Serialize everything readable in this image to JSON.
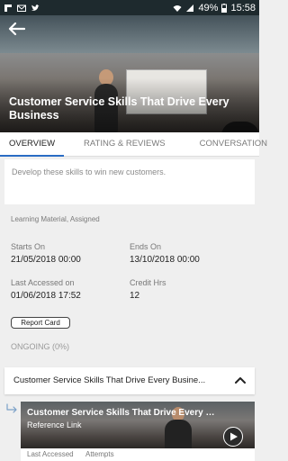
{
  "status_bar": {
    "battery": "49%",
    "time": "15:58",
    "icons": [
      "flipboard-icon",
      "gmail-icon",
      "twitter-icon",
      "wifi-icon",
      "signal-icon",
      "battery-icon"
    ]
  },
  "header": {
    "back_icon": "arrow-left-icon",
    "title": "Customer Service Skills That Drive Every Business"
  },
  "tabs": [
    {
      "label": "OVERVIEW",
      "active": true
    },
    {
      "label": "RATING & REVIEWS",
      "active": false
    },
    {
      "label": "CONVERSATION",
      "active": false
    }
  ],
  "overview": {
    "description": "Develop these skills to win new customers.",
    "meta": "Learning Material, Assigned",
    "starts_on_label": "Starts On",
    "starts_on_value": "21/05/2018 00:00",
    "ends_on_label": "Ends On",
    "ends_on_value": "13/10/2018 00:00",
    "last_accessed_label": "Last Accessed on",
    "last_accessed_value": "01/06/2018 17:52",
    "credit_hrs_label": "Credit Hrs",
    "credit_hrs_value": "12",
    "report_card_button": "Report Card",
    "status": "ONGOING (0%)"
  },
  "content_section": {
    "title": "Customer Service Skills That Drive Every Busine...",
    "expanded": true,
    "items": [
      {
        "title": "Customer Service Skills That Drive Every B...",
        "type": "Reference Link",
        "last_accessed_label": "Last Accessed",
        "attempts_label": "Attempts"
      }
    ]
  },
  "colors": {
    "accent": "#2a6cc4",
    "status_bar": "#1e2a2e",
    "background": "#efefef"
  }
}
